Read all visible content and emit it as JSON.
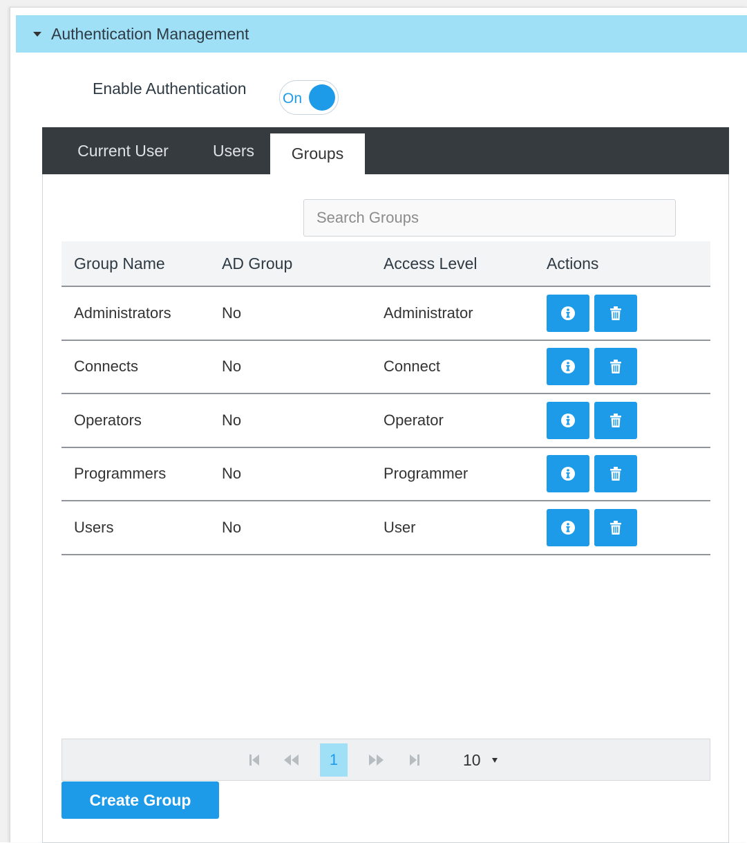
{
  "section": {
    "title": "Authentication Management"
  },
  "enable": {
    "label": "Enable Authentication",
    "toggle_text": "On"
  },
  "tabs": [
    {
      "label": "Current User"
    },
    {
      "label": "Users"
    },
    {
      "label": "Groups"
    }
  ],
  "search": {
    "placeholder": "Search Groups"
  },
  "table": {
    "headers": [
      "Group Name",
      "AD Group",
      "Access Level",
      "Actions"
    ],
    "rows": [
      [
        "Administrators",
        "No",
        "Administrator"
      ],
      [
        "Connects",
        "No",
        "Connect"
      ],
      [
        "Operators",
        "No",
        "Operator"
      ],
      [
        "Programmers",
        "No",
        "Programmer"
      ],
      [
        "Users",
        "No",
        "User"
      ]
    ]
  },
  "pager": {
    "current_page": "1",
    "page_size": "10"
  },
  "create_button": "Create Group",
  "colors": {
    "accent": "#1d9be8",
    "header_bg": "#9fe0f7",
    "tabbar": "#363b40"
  }
}
